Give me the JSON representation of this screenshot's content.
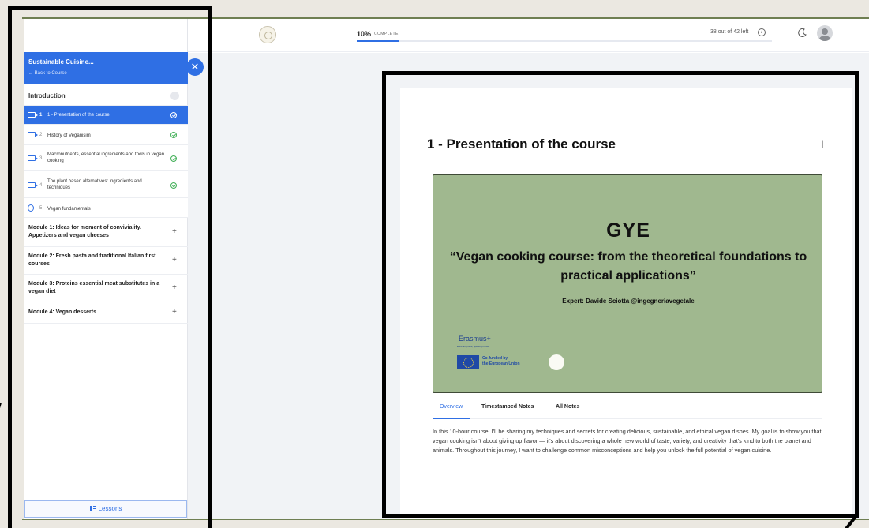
{
  "header": {
    "progress_percent": "10%",
    "progress_label": "COMPLETE",
    "progress_value": 0.1,
    "left_count": "38 out of 42 left"
  },
  "sidebar": {
    "course_title": "Sustainable Cuisine...",
    "back_label": "← Back to Course",
    "section_label": "Introduction",
    "lessons": [
      {
        "num": "1",
        "title": "1 - Presentation of the course",
        "type": "video",
        "active": true
      },
      {
        "num": "2",
        "title": "History of Veganisim",
        "type": "video",
        "active": false
      },
      {
        "num": "3",
        "title": "Macronutrients, essential ingredients and tools in vegan cooking",
        "type": "video",
        "active": false
      },
      {
        "num": "4",
        "title": "The plant based alternatives: ingredients and techniques",
        "type": "video",
        "active": false
      },
      {
        "num": "5",
        "title": "Vegan fundamentals",
        "type": "quiz",
        "active": false
      }
    ],
    "modules": [
      "Module 1: Ideas for moment of conviviality. Appetizers and vegan cheeses",
      "Module 2: Fresh pasta and traditional Italian first courses",
      "Module 3: Proteins essential meat substitutes in a vegan diet",
      "Module 4: Vegan desserts"
    ],
    "lessons_button": "Lessons"
  },
  "content": {
    "title": "1 - Presentation of the course",
    "video": {
      "brand": "GYE",
      "subtitle": "“Vegan cooking course: from the theoretical foundations to practical applications”",
      "expert": "Expert: Davide Sciotta @ingegneriavegetale",
      "erasmus": "Erasmus+",
      "erasmus_tagline": "Enriching lives, opening minds.",
      "eu_line1": "Co-funded by",
      "eu_line2": "the European Union"
    },
    "tabs": [
      "Overview",
      "Timestamped Notes",
      "All Notes"
    ],
    "overview_text": "In this 10-hour course, I'll be sharing my techniques and secrets for creating delicious, sustainable, and ethical vegan dishes. My goal is to show you that vegan cooking isn't about giving up flavor — it's about discovering a whole new world of taste, variety, and creativity that's kind to both the planet and animals. Throughout this journey, I want to challenge common misconceptions and help you unlock the full potential of vegan cuisine."
  },
  "colors": {
    "accent": "#2f6fe4",
    "video_bg": "#a0b88f",
    "check": "#3fae55"
  }
}
